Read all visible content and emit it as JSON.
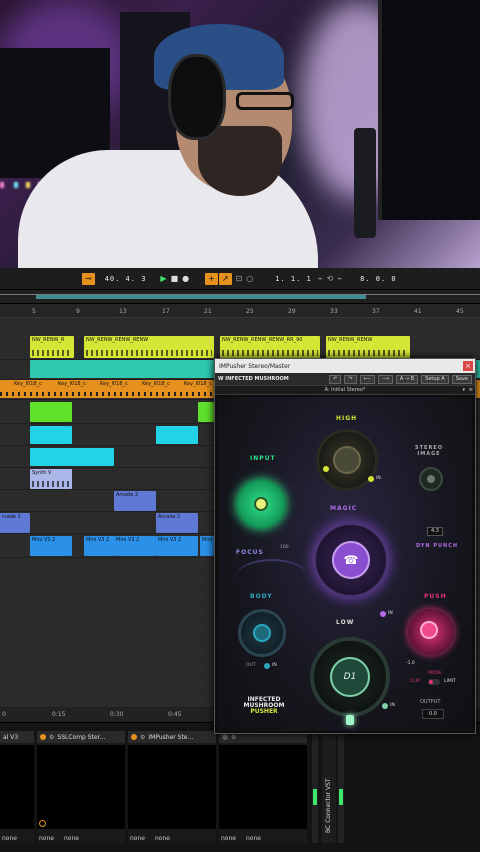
{
  "transport": {
    "position": "40. 4. 3",
    "loop_start": "1. 1. 1",
    "loop_length": "8. 0. 0"
  },
  "ruler": {
    "bars": [
      "5",
      "9",
      "13",
      "17",
      "21",
      "25",
      "29",
      "33",
      "37",
      "41",
      "45"
    ]
  },
  "clips": {
    "nw_renw": [
      "NW_RENW_R",
      "NW_RENW_RENW_RENW",
      "NW_RENW_RENW_RENW_RR_90",
      "NW_RENW_RENW"
    ],
    "key_clips": [
      "Key_I018_c",
      "Key_I018_c",
      "Key_I018_c",
      "Key_I018_c",
      "Key_I018_c",
      "Key_I018_c"
    ],
    "synth": "Synth V",
    "arcade_1": "Arcade 2",
    "arcade_2": "Arcade 2",
    "arcade_3": "rcade 2",
    "mini_v3": [
      "Mini V3 2",
      "Mini V3 2",
      "Mini V3 2",
      "Mini V3 2",
      "Mini"
    ]
  },
  "timeline2": {
    "marks": [
      "0",
      "0:15",
      "0:30",
      "0:45"
    ]
  },
  "mixer": {
    "slots": [
      {
        "title": "al V3",
        "foot": [
          "none"
        ]
      },
      {
        "title": "SSLComp Ster...",
        "foot": [
          "none",
          "none"
        ]
      },
      {
        "title": "IMPusher Ste...",
        "foot": [
          "none",
          "none"
        ]
      },
      {
        "title": "",
        "foot": [
          "none",
          "none"
        ]
      }
    ],
    "vertical_label": "BC Connector VST"
  },
  "plugin": {
    "window_title": "IMPusher Stereo/Master",
    "brand": "W INFECTED MUSHROOM",
    "toolbar_buttons": [
      "↶",
      "↷",
      "⟵",
      "⟶",
      "A → B",
      "Setup A",
      "Save"
    ],
    "preset": "A: Initial Stereo*",
    "labels": {
      "high": "HIGH",
      "input": "INPUT",
      "stereo_image": "STEREO IMAGE",
      "magic": "MAGIC",
      "focus": "FOCUS",
      "dyn_punch": "DYN PUNCH",
      "body": "BODY",
      "push": "PUSH",
      "low": "LOW",
      "output": "OUTPUT",
      "in1": "IN",
      "in2": "IN",
      "in3": "IN",
      "in4": "IN",
      "out": "OUT",
      "mode": "MODE",
      "clip": "CLIP",
      "limit": "LIMIT",
      "d1": "D1",
      "logo_line1": "INFECTED",
      "logo_line2": "MUSHROOM",
      "logo_line3": "PUSHER",
      "val_100": "100",
      "val_neg1": "-1.0"
    },
    "dyn_punch_value": "4.3",
    "output_value": "0.0"
  },
  "colors": {
    "accent_orange": "#e6911e",
    "clip_green": "#7ed321",
    "clip_cyan": "#22d3e6",
    "clip_yellow": "#d6e637",
    "clip_blue": "#2b90e8",
    "input_green": "#2fe08a",
    "magic_purple": "#8a4fd0",
    "push_pink": "#e0347a",
    "body_teal": "#2aa8c0"
  }
}
